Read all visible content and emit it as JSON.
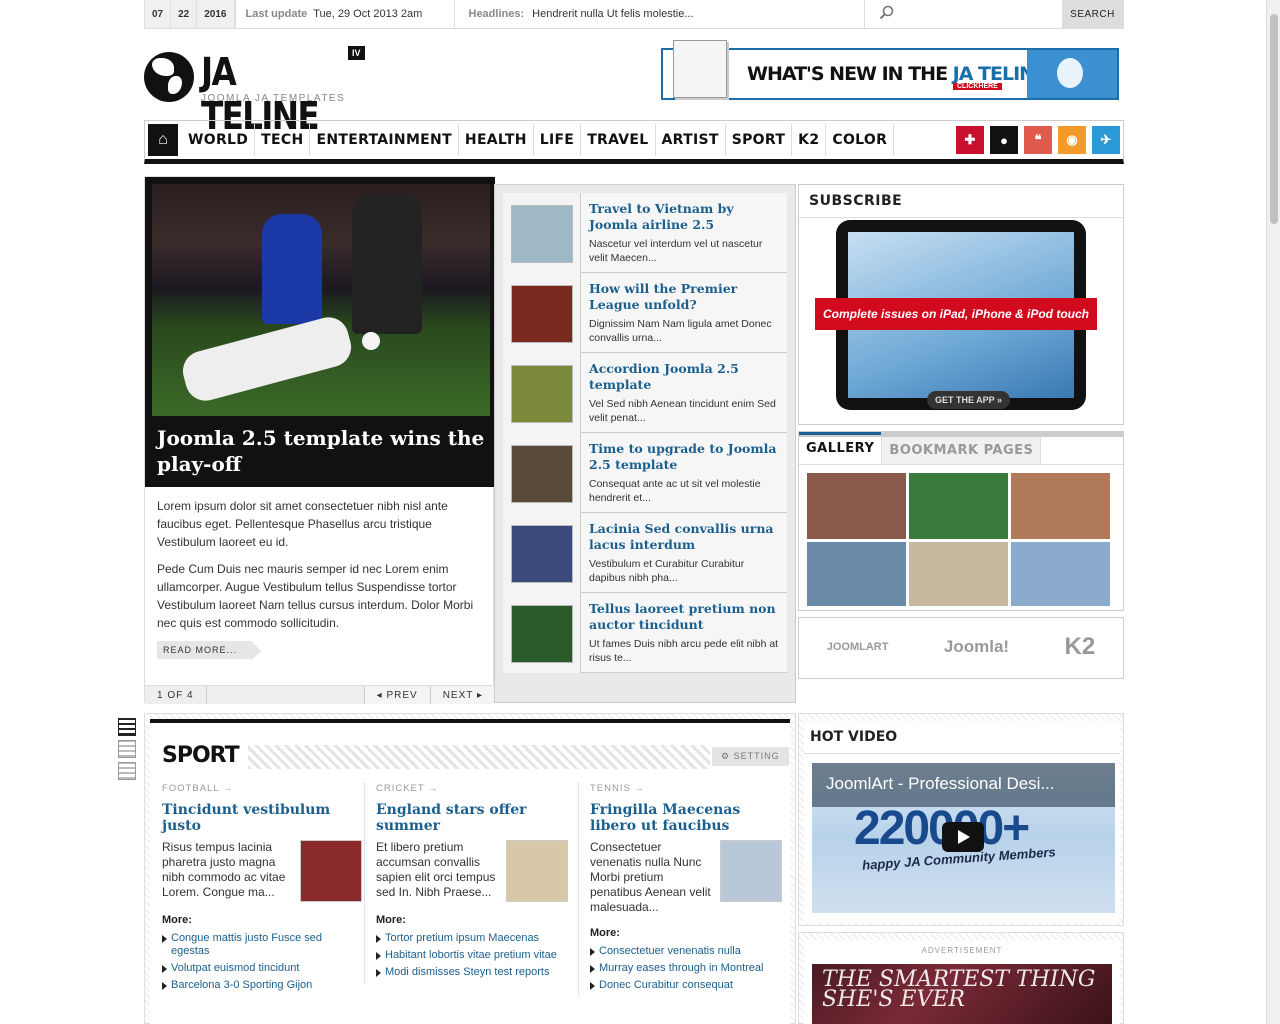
{
  "topbar": {
    "date": {
      "month": "07",
      "day": "22",
      "year": "2016"
    },
    "last_update_label": "Last update",
    "last_update_value": "Tue, 29 Oct 2013 2am",
    "headlines_label": "Headlines:",
    "headlines_value": "Hendrerit nulla Ut felis molestie...",
    "search_placeholder": "",
    "search_button": "SEARCH"
  },
  "logo": {
    "title": "JA TELINE",
    "badge": "IV",
    "subtitle": "JOOMLA JA TEMPLATES"
  },
  "banner": {
    "text_a": "WHAT'S NEW IN THE ",
    "text_b": "JA TELINE IV?",
    "click": "CLICKHERE"
  },
  "nav": {
    "items": [
      "WORLD",
      "TECH",
      "ENTERTAINMENT",
      "HEALTH",
      "LIFE",
      "TRAVEL",
      "ARTIST",
      "SPORT",
      "K2",
      "COLOR"
    ],
    "icons": [
      {
        "name": "uk-flag-icon",
        "glyph": "✚",
        "color": "#c8102e"
      },
      {
        "name": "user-icon",
        "glyph": "●",
        "color": "#111111"
      },
      {
        "name": "quote-icon",
        "glyph": "❝",
        "color": "#e05a4e"
      },
      {
        "name": "rss-icon",
        "glyph": "◉",
        "color": "#f39a2a"
      },
      {
        "name": "twitter-icon",
        "glyph": "✈",
        "color": "#2a9ad6"
      }
    ]
  },
  "featured": {
    "title": "Joomla 2.5 template wins the play-off",
    "p1": "Lorem ipsum dolor sit amet consectetuer nibh nisl ante faucibus eget. Pellentesque Phasellus arcu tristique Vestibulum laoreet eu id.",
    "p2": "Pede Cum Duis nec mauris semper id nec Lorem enim ullamcorper. Augue Vestibulum tellus Suspendisse tortor Vestibulum laoreet Nam tellus cursus interdum. Dolor Morbi nec quis est commodo sollicitudin.",
    "read_more": "READ MORE...",
    "counter": "1 OF 4",
    "prev": "◂ PREV",
    "next": "NEXT ▸"
  },
  "articles": [
    {
      "title": "Travel to Vietnam by Joomla airline 2.5",
      "summary": "Nascetur vel interdum vel ut nascetur velit Maecen...",
      "thumb_color": "#9fb8c8"
    },
    {
      "title": "How will the Premier League unfold?",
      "summary": "Dignissim Nam Nam ligula amet Donec convallis urna...",
      "thumb_color": "#7a2a1e"
    },
    {
      "title": "Accordion Joomla 2.5 template",
      "summary": "Vel Sed nibh Aenean tincidunt enim Sed velit penat...",
      "thumb_color": "#7a8a3a"
    },
    {
      "title": "Time to upgrade to Joomla 2.5 template",
      "summary": "Consequat ante ac ut sit vel molestie hendrerit et...",
      "thumb_color": "#5a4a3a"
    },
    {
      "title": "Lacinia Sed convallis urna lacus interdum",
      "summary": "Vestibulum et Curabitur Curabitur dapibus nibh pha...",
      "thumb_color": "#3a4a7a"
    },
    {
      "title": "Tellus laoreet pretium non auctor tincidunt",
      "summary": "Ut fames Duis nibh arcu pede elit nibh at risus te...",
      "thumb_color": "#2a5a2a"
    }
  ],
  "subscribe": {
    "title": "SUBSCRIBE",
    "ribbon": "Complete issues on iPad, iPhone & iPod touch",
    "button": "GET THE APP »"
  },
  "gallery": {
    "tab_active": "GALLERY",
    "tab_inactive": "BOOKMARK PAGES",
    "colors": [
      "#8a5a4a",
      "#3a7a3a",
      "#b07a5a",
      "#6a8aa8",
      "#c8b8a0",
      "#8aaace"
    ]
  },
  "brands": [
    "JOOMLART",
    "Joomla!",
    "K2"
  ],
  "sport": {
    "title": "SPORT",
    "setting": "SETTING",
    "columns": [
      {
        "category": "FOOTBALL",
        "title": "Tincidunt vestibulum justo",
        "text": "Risus tempus lacinia pharetra justo magna nibh commodo ac vitae Lorem. Congue ma...",
        "img_color": "#8a2a2a",
        "more": "More:",
        "links": [
          "Congue mattis justo Fusce sed egestas",
          "Volutpat euismod tincidunt",
          "Barcelona 3-0 Sporting Gijon"
        ]
      },
      {
        "category": "CRICKET",
        "title": "England stars offer summer",
        "text": "Et libero pretium accumsan convallis sapien elit orci tempus sed In. Nibh Praese...",
        "img_color": "#d8c8a8",
        "more": "More:",
        "links": [
          "Tortor pretium ipsum Maecenas",
          "Habitant lobortis vitae pretium vitae",
          "Modi dismisses Steyn test reports"
        ]
      },
      {
        "category": "TENNIS",
        "title": "Fringilla Maecenas libero ut faucibus",
        "text": "Consectetuer venenatis nulla Nunc Morbi pretium penatibus Aenean velit malesuada...",
        "img_color": "#b8c8d8",
        "more": "More:",
        "links": [
          "Consectetuer venenatis nulla",
          "Murray eases through in Montreal",
          "Donec Curabitur consequat"
        ]
      }
    ]
  },
  "hot_video": {
    "title": "HOT VIDEO",
    "video_title": "JoomlArt - Professional Desi...",
    "big_text": "220000+",
    "small_text": "happy JA Community Members"
  },
  "ad": {
    "label": "ADVERTISEMENT",
    "text": "THE SMARTEST THING SHE'S EVER"
  }
}
